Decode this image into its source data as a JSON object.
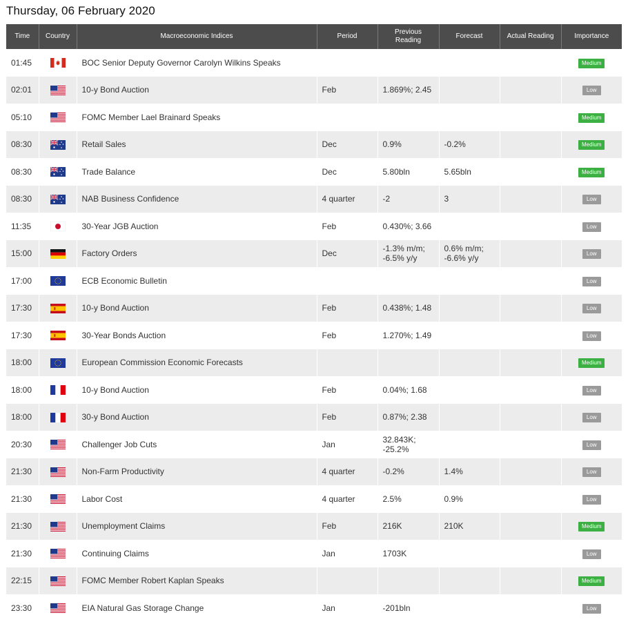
{
  "page_title": "Thursday, 06 February 2020",
  "columns": {
    "time": "Time",
    "country": "Country",
    "indices": "Macroeconomic Indices",
    "period": "Period",
    "previous": "Previous Reading",
    "forecast": "Forecast",
    "actual": "Actual Reading",
    "importance": "Importance"
  },
  "colors": {
    "header_bg": "#4c4c4c",
    "medium": "#3cb043",
    "low": "#9a9a9a",
    "row_alt": "#ececec"
  },
  "rows": [
    {
      "time": "01:45",
      "flag": "ca-flag-icon",
      "event": "BOC Senior Deputy Governor Carolyn Wilkins Speaks",
      "period": "",
      "previous": "",
      "forecast": "",
      "actual": "",
      "importance": "Medium"
    },
    {
      "time": "02:01",
      "flag": "us-flag-icon",
      "event": "10-y Bond Auction",
      "period": "Feb",
      "previous": "1.869%; 2.45",
      "forecast": "",
      "actual": "",
      "importance": "Low"
    },
    {
      "time": "05:10",
      "flag": "us-flag-icon",
      "event": "FOMC Member Lael Brainard Speaks",
      "period": "",
      "previous": "",
      "forecast": "",
      "actual": "",
      "importance": "Medium"
    },
    {
      "time": "08:30",
      "flag": "au-flag-icon",
      "event": "Retail Sales",
      "period": "Dec",
      "previous": "0.9%",
      "forecast": "-0.2%",
      "actual": "",
      "importance": "Medium"
    },
    {
      "time": "08:30",
      "flag": "au-flag-icon",
      "event": "Trade Balance",
      "period": "Dec",
      "previous": "5.80bln",
      "forecast": "5.65bln",
      "actual": "",
      "importance": "Medium"
    },
    {
      "time": "08:30",
      "flag": "au-flag-icon",
      "event": "NAB Business Confidence",
      "period": "4 quarter",
      "previous": "-2",
      "forecast": "3",
      "actual": "",
      "importance": "Low"
    },
    {
      "time": "11:35",
      "flag": "jp-flag-icon",
      "event": "30-Year JGB Auction",
      "period": "Feb",
      "previous": "0.430%; 3.66",
      "forecast": "",
      "actual": "",
      "importance": "Low"
    },
    {
      "time": "15:00",
      "flag": "de-flag-icon",
      "event": "Factory Orders",
      "period": "Dec",
      "previous": "-1.3% m/m; -6.5% y/y",
      "forecast": "0.6% m/m; -6.6% y/y",
      "actual": "",
      "importance": "Low"
    },
    {
      "time": "17:00",
      "flag": "eu-flag-icon",
      "event": "ECB Economic Bulletin",
      "period": "",
      "previous": "",
      "forecast": "",
      "actual": "",
      "importance": "Low"
    },
    {
      "time": "17:30",
      "flag": "es-flag-icon",
      "event": "10-y Bond Auction",
      "period": "Feb",
      "previous": "0.438%; 1.48",
      "forecast": "",
      "actual": "",
      "importance": "Low"
    },
    {
      "time": "17:30",
      "flag": "es-flag-icon",
      "event": "30-Year Bonds Auction",
      "period": "Feb",
      "previous": "1.270%; 1.49",
      "forecast": "",
      "actual": "",
      "importance": "Low"
    },
    {
      "time": "18:00",
      "flag": "eu-flag-icon",
      "event": "European Commission Economic Forecasts",
      "period": "",
      "previous": "",
      "forecast": "",
      "actual": "",
      "importance": "Medium"
    },
    {
      "time": "18:00",
      "flag": "fr-flag-icon",
      "event": "10-y Bond Auction",
      "period": "Feb",
      "previous": "0.04%; 1.68",
      "forecast": "",
      "actual": "",
      "importance": "Low"
    },
    {
      "time": "18:00",
      "flag": "fr-flag-icon",
      "event": "30-y Bond Auction",
      "period": "Feb",
      "previous": "0.87%; 2.38",
      "forecast": "",
      "actual": "",
      "importance": "Low"
    },
    {
      "time": "20:30",
      "flag": "us-flag-icon",
      "event": "Challenger Job Cuts",
      "period": "Jan",
      "previous": "32.843K; -25.2%",
      "forecast": "",
      "actual": "",
      "importance": "Low"
    },
    {
      "time": "21:30",
      "flag": "us-flag-icon",
      "event": "Non-Farm Productivity",
      "period": "4 quarter",
      "previous": "-0.2%",
      "forecast": "1.4%",
      "actual": "",
      "importance": "Low"
    },
    {
      "time": "21:30",
      "flag": "us-flag-icon",
      "event": "Labor Cost",
      "period": "4 quarter",
      "previous": "2.5%",
      "forecast": "0.9%",
      "actual": "",
      "importance": "Low"
    },
    {
      "time": "21:30",
      "flag": "us-flag-icon",
      "event": "Unemployment Claims",
      "period": "Feb",
      "previous": "216K",
      "forecast": "210K",
      "actual": "",
      "importance": "Medium"
    },
    {
      "time": "21:30",
      "flag": "us-flag-icon",
      "event": "Continuing Claims",
      "period": "Jan",
      "previous": "1703K",
      "forecast": "",
      "actual": "",
      "importance": "Low"
    },
    {
      "time": "22:15",
      "flag": "us-flag-icon",
      "event": "FOMC Member Robert Kaplan Speaks",
      "period": "",
      "previous": "",
      "forecast": "",
      "actual": "",
      "importance": "Medium"
    },
    {
      "time": "23:30",
      "flag": "us-flag-icon",
      "event": "EIA Natural Gas Storage Change",
      "period": "Jan",
      "previous": "-201bln",
      "forecast": "",
      "actual": "",
      "importance": "Low"
    }
  ]
}
